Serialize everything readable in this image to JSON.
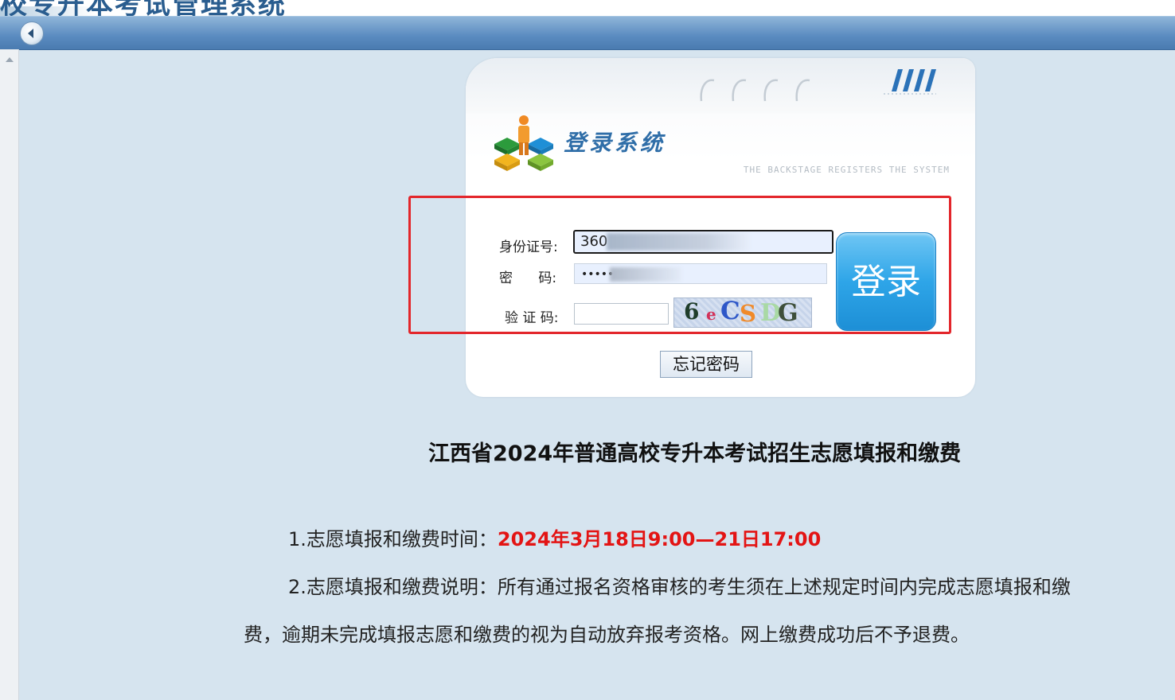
{
  "window": {
    "title": "校专升本考试管理系统"
  },
  "toolbar": {
    "back_icon": "back-arrow-icon"
  },
  "login": {
    "title": "登录系统",
    "subtitle": "THE BACKSTAGE REGISTERS THE SYSTEM",
    "id_label": "身份证号:",
    "id_value": "360",
    "password_label": "密      码:",
    "password_value": "•••••",
    "captcha_label": "验 证 码:",
    "captcha_value": "",
    "captcha_text": [
      "6",
      "e",
      "C",
      "S",
      "D",
      "G"
    ],
    "login_button": "登录",
    "forgot_button": "忘记密码"
  },
  "notice": {
    "title": "江西省2024年普通高校专升本考试招生志愿填报和缴费",
    "item1_prefix": "1.志愿填报和缴费时间：",
    "item1_time": "2024年3月18日9:00—21日17:00",
    "item2_line1": "2.志愿填报和缴费说明：所有通过报名资格审核的考生须在上述规定时间内完成志愿填报和缴",
    "item2_line2": "费，逾期未完成填报志愿和缴费的视为自动放弃报考资格。网上缴费成功后不予退费。"
  },
  "colors": {
    "highlight_red": "#e31414",
    "frame_red": "#e3262b",
    "login_blue": "#2ea5e8",
    "toolbar_blue": "#5a8bc0"
  }
}
